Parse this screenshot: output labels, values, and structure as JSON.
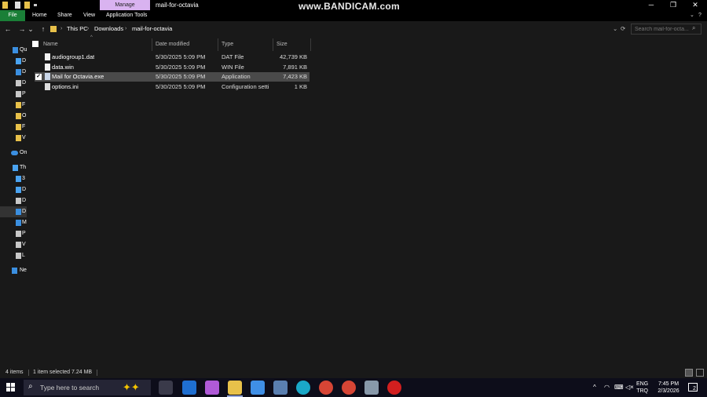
{
  "titlebar": {
    "manage_tab": "Manage",
    "window_title": "mail-for-octavia",
    "watermark": "www.BANDICAM.com",
    "minimize": "─",
    "maximize": "❐",
    "close": "✕"
  },
  "ribbon": {
    "tabs": [
      "File",
      "Home",
      "Share",
      "View",
      "Application Tools"
    ],
    "collapse_icon": "chevron-down-icon",
    "help_icon": "help-icon"
  },
  "addressbar": {
    "back": "←",
    "forward": "→",
    "recent": "⌄",
    "up": "↑",
    "crumbs": [
      "This PC",
      "Downloads",
      "mail-for-octavia"
    ],
    "search_placeholder": "Search mail-for-octa...",
    "refresh": "⟳",
    "dropdown": "⌄"
  },
  "navpane": {
    "items": [
      {
        "label": "Qu",
        "icon": "star-icon",
        "color": "#3b8fe0"
      },
      {
        "label": "D",
        "icon": "desktop-icon",
        "color": "#4aa3f0"
      },
      {
        "label": "D",
        "icon": "download-icon",
        "color": "#3b8fe0"
      },
      {
        "label": "D",
        "icon": "document-icon",
        "color": "#c8c8c8"
      },
      {
        "label": "P",
        "icon": "picture-icon",
        "color": "#c8c8c8"
      },
      {
        "label": "F",
        "icon": "folder-icon",
        "color": "#e8c14a"
      },
      {
        "label": "O",
        "icon": "folder-icon",
        "color": "#e8c14a"
      },
      {
        "label": "F",
        "icon": "folder-icon",
        "color": "#e8c14a"
      },
      {
        "label": "V",
        "icon": "folder-icon",
        "color": "#e8c14a"
      },
      {
        "label": "On",
        "icon": "cloud-icon",
        "color": "#3b8fe0"
      },
      {
        "label": "Th",
        "icon": "pc-icon",
        "color": "#4aa3f0"
      },
      {
        "label": "3",
        "icon": "cube-icon",
        "color": "#4aa3f0"
      },
      {
        "label": "D",
        "icon": "desktop-icon",
        "color": "#4aa3f0"
      },
      {
        "label": "D",
        "icon": "document-icon",
        "color": "#c8c8c8"
      },
      {
        "label": "D",
        "icon": "download-icon",
        "color": "#3b8fe0"
      },
      {
        "label": "M",
        "icon": "music-icon",
        "color": "#3b8fe0"
      },
      {
        "label": "P",
        "icon": "picture-icon",
        "color": "#c8c8c8"
      },
      {
        "label": "V",
        "icon": "video-icon",
        "color": "#c8c8c8"
      },
      {
        "label": "L",
        "icon": "drive-icon",
        "color": "#c8c8c8"
      },
      {
        "label": "Ne",
        "icon": "network-icon",
        "color": "#3b8fe0"
      }
    ]
  },
  "filelist": {
    "columns": [
      "Name",
      "Date modified",
      "Type",
      "Size"
    ],
    "rows": [
      {
        "name": "audiogroup1.dat",
        "date": "5/30/2025 5:09 PM",
        "type": "DAT File",
        "size": "42,739 KB",
        "selected": false
      },
      {
        "name": "data.win",
        "date": "5/30/2025 5:09 PM",
        "type": "WIN File",
        "size": "7,891 KB",
        "selected": false
      },
      {
        "name": "Mail for Octavia.exe",
        "date": "5/30/2025 5:09 PM",
        "type": "Application",
        "size": "7,423 KB",
        "selected": true
      },
      {
        "name": "options.ini",
        "date": "5/30/2025 5:09 PM",
        "type": "Configuration setti...",
        "size": "1 KB",
        "selected": false
      }
    ]
  },
  "statusbar": {
    "item_count": "4 items",
    "selection": "1 item selected  7.24 MB"
  },
  "taskbar": {
    "search_text": "Type here to search",
    "lang": "ENG",
    "region": "TRQ",
    "time": "7:45 PM",
    "date": "2/3/2026",
    "notification_count": "2",
    "tray_up": "^",
    "apps": [
      {
        "name": "task-view",
        "color": "#3a3a4a"
      },
      {
        "name": "outlook",
        "color": "#1f6fd1"
      },
      {
        "name": "copilot",
        "color": "#b05ad8"
      },
      {
        "name": "file-explorer",
        "color": "#e8c14a"
      },
      {
        "name": "store",
        "color": "#3f8fe6"
      },
      {
        "name": "monitor",
        "color": "#5a7fb0"
      },
      {
        "name": "edge",
        "color": "#1aa8c8"
      },
      {
        "name": "chrome",
        "color": "#d64535"
      },
      {
        "name": "chrome-profile",
        "color": "#d64535"
      },
      {
        "name": "app-window",
        "color": "#8899aa"
      },
      {
        "name": "bandicam",
        "color": "#d21f1f"
      }
    ]
  }
}
